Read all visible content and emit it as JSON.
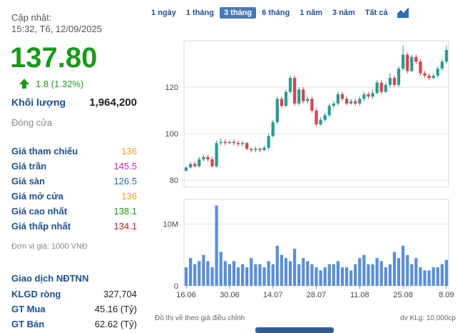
{
  "update": {
    "label": "Cập nhật:",
    "time": "15:32, T6, 12/09/2025"
  },
  "quote": {
    "price": "137.80",
    "change": "1.8 (1.32%)",
    "volume_label": "Khối lượng",
    "volume": "1,964,200",
    "status": "Đóng cửa"
  },
  "prices": [
    {
      "label": "Giá tham chiếu",
      "value": "136",
      "color": "#f0a020"
    },
    {
      "label": "Giá trần",
      "value": "145.5",
      "color": "#d020c0"
    },
    {
      "label": "Giá sàn",
      "value": "126.5",
      "color": "#1d6fb8"
    },
    {
      "label": "Giá mở cửa",
      "value": "136",
      "color": "#f0a020"
    },
    {
      "label": "Giá cao nhất",
      "value": "138.1",
      "color": "#1a9a1a"
    },
    {
      "label": "Giá thấp nhất",
      "value": "134.1",
      "color": "#d02020"
    }
  ],
  "unit_note": "Đơn vị giá: 1000 VNĐ",
  "foreign": {
    "title": "Giao dịch NĐTNN",
    "rows": [
      {
        "label": "KLGD ròng",
        "value": "327,704"
      },
      {
        "label": "GT Mua",
        "value": "45.16 (Tỷ)"
      },
      {
        "label": "GT Bán",
        "value": "62.62 (Tỷ)"
      }
    ]
  },
  "tabs": [
    {
      "label": "1 ngày",
      "active": false
    },
    {
      "label": "1 tháng",
      "active": false
    },
    {
      "label": "3 tháng",
      "active": true
    },
    {
      "label": "6 tháng",
      "active": false
    },
    {
      "label": "1 năm",
      "active": false
    },
    {
      "label": "3 năm",
      "active": false
    },
    {
      "label": "Tất cả",
      "active": false
    }
  ],
  "chart_icon": "area-chart-icon",
  "colors": {
    "up": "#2e9a8e",
    "down": "#d9434b",
    "volume": "#5b8fd6",
    "accent": "#1d4f8e"
  },
  "footer": {
    "note": "Đồ thị vẽ theo giá điều chỉnh",
    "unit": "dv KLg: 10,000cp"
  },
  "chart_data": {
    "type": "candlestick",
    "price_ticks": [
      80,
      100,
      120
    ],
    "ylim": [
      77,
      140
    ],
    "volume_ticks": [
      "0",
      "10M"
    ],
    "volume_tick_values": [
      0,
      10000000
    ],
    "volume_max": 14000000,
    "x_ticks": [
      "16.06",
      "30.06",
      "14.07",
      "28.07",
      "11.08",
      "25.08",
      "8.09"
    ],
    "x_tick_index": [
      0,
      10,
      20,
      30,
      40,
      50,
      60
    ],
    "candles": [
      [
        84,
        85.5,
        84,
        86
      ],
      [
        85.5,
        87,
        85,
        88
      ],
      [
        87,
        86,
        85.5,
        88
      ],
      [
        86,
        89,
        85.5,
        90
      ],
      [
        89,
        90,
        88,
        91
      ],
      [
        90,
        89,
        88,
        91
      ],
      [
        89,
        86,
        85.5,
        90
      ],
      [
        86,
        96,
        85.5,
        97
      ],
      [
        96,
        96.5,
        95,
        98
      ],
      [
        96.5,
        96,
        95,
        97.5
      ],
      [
        96,
        96.5,
        95.5,
        97
      ],
      [
        96.5,
        96,
        95,
        97.5
      ],
      [
        96,
        95.5,
        94.5,
        97
      ],
      [
        95.5,
        96,
        94.5,
        97
      ],
      [
        96,
        93.5,
        93,
        96.5
      ],
      [
        93.5,
        93,
        92,
        94
      ],
      [
        93,
        93.5,
        92,
        94.5
      ],
      [
        93.5,
        93,
        92,
        94
      ],
      [
        93,
        94,
        92.5,
        95
      ],
      [
        94,
        99,
        93,
        100
      ],
      [
        99,
        105,
        98.5,
        106
      ],
      [
        105,
        115,
        104,
        116
      ],
      [
        115,
        112,
        111,
        116
      ],
      [
        112,
        118,
        111.5,
        119
      ],
      [
        118,
        124,
        117,
        125
      ],
      [
        124,
        113,
        112,
        125
      ],
      [
        113,
        119,
        112,
        120
      ],
      [
        119,
        114,
        113,
        120
      ],
      [
        114,
        115,
        113,
        116
      ],
      [
        115,
        110,
        109,
        116
      ],
      [
        110,
        104,
        103.5,
        111
      ],
      [
        104,
        106,
        103.5,
        107
      ],
      [
        106,
        108,
        105,
        109
      ],
      [
        108,
        112,
        107,
        113
      ],
      [
        112,
        113,
        111,
        114
      ],
      [
        113,
        117,
        112,
        118
      ],
      [
        117,
        115,
        114,
        118
      ],
      [
        115,
        113,
        112,
        116
      ],
      [
        113,
        114,
        112.5,
        115
      ],
      [
        114,
        113,
        112,
        115
      ],
      [
        113,
        115,
        112,
        116
      ],
      [
        115,
        117,
        114,
        118
      ],
      [
        117,
        116,
        115,
        118
      ],
      [
        116,
        117.5,
        115,
        119
      ],
      [
        117.5,
        122,
        117,
        123
      ],
      [
        122,
        118,
        117,
        123
      ],
      [
        118,
        121,
        117.5,
        122
      ],
      [
        121,
        124,
        120,
        126
      ],
      [
        124,
        121,
        120,
        125
      ],
      [
        121,
        128,
        120,
        129
      ],
      [
        128,
        134,
        127,
        138
      ],
      [
        134,
        127,
        126,
        135
      ],
      [
        127,
        133,
        126.5,
        134
      ],
      [
        133,
        131,
        130,
        134
      ],
      [
        131,
        126,
        125,
        132
      ],
      [
        126,
        125,
        124,
        127
      ],
      [
        125,
        124,
        123,
        126
      ],
      [
        124,
        125,
        123.5,
        126
      ],
      [
        125,
        128,
        124,
        129
      ],
      [
        128,
        131,
        127,
        132
      ],
      [
        131,
        136,
        130,
        138
      ]
    ],
    "volumes": [
      3000000,
      4500000,
      3500000,
      4000000,
      5000000,
      4000000,
      3000000,
      13000000,
      5500000,
      4000000,
      3500000,
      4000000,
      3000000,
      3500000,
      3000000,
      4500000,
      3500000,
      3500000,
      3000000,
      4000000,
      3500000,
      6500000,
      5000000,
      4500000,
      4000000,
      6000000,
      3500000,
      4500000,
      4000000,
      3500000,
      3000000,
      2500000,
      3000000,
      3500000,
      3500000,
      4000000,
      3000000,
      3000000,
      2500000,
      3500000,
      4500000,
      5000000,
      3500000,
      3500000,
      4500000,
      4000000,
      3000000,
      3500000,
      5500000,
      4500000,
      6500000,
      5000000,
      3500000,
      4500000,
      3000000,
      2500000,
      2500000,
      3000000,
      3000000,
      3500000,
      4200000
    ]
  }
}
